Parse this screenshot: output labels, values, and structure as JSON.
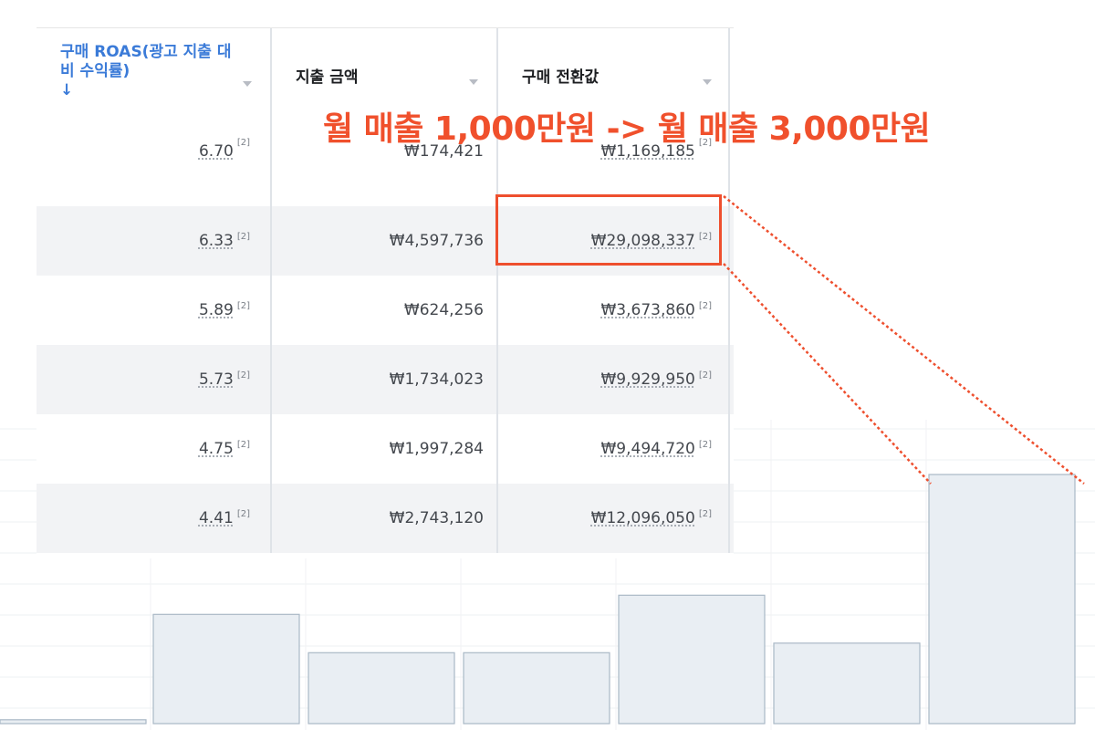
{
  "annotation": {
    "headline": "월 매출 1,000만원 -> 월 매출 3,000만원",
    "color": "#f0502c"
  },
  "table": {
    "columns": [
      {
        "label": "구매 ROAS(광고 지출 대비 수익률)",
        "sort_indicator": "↓",
        "color": "#3b7bd8"
      },
      {
        "label": "지출 금액"
      },
      {
        "label": "구매 전환값"
      }
    ],
    "rows": [
      {
        "roas": "6.70",
        "spend": "₩174,421",
        "value": "₩1,169,185",
        "note": "[2]"
      },
      {
        "roas": "6.33",
        "spend": "₩4,597,736",
        "value": "₩29,098,337",
        "note": "[2]"
      },
      {
        "roas": "5.89",
        "spend": "₩624,256",
        "value": "₩3,673,860",
        "note": "[2]"
      },
      {
        "roas": "5.73",
        "spend": "₩1,734,023",
        "value": "₩9,929,950",
        "note": "[2]"
      },
      {
        "roas": "4.75",
        "spend": "₩1,997,284",
        "value": "₩9,494,720",
        "note": "[2]"
      },
      {
        "roas": "4.41",
        "spend": "₩2,743,120",
        "value": "₩12,096,050",
        "note": "[2]"
      }
    ],
    "highlighted_row": 1
  },
  "background_chart": {
    "bar_values": [
      2,
      57,
      37,
      37,
      67,
      42,
      130
    ],
    "bar_fill": "#e9eef3",
    "bar_stroke": "#a9b8c6"
  }
}
